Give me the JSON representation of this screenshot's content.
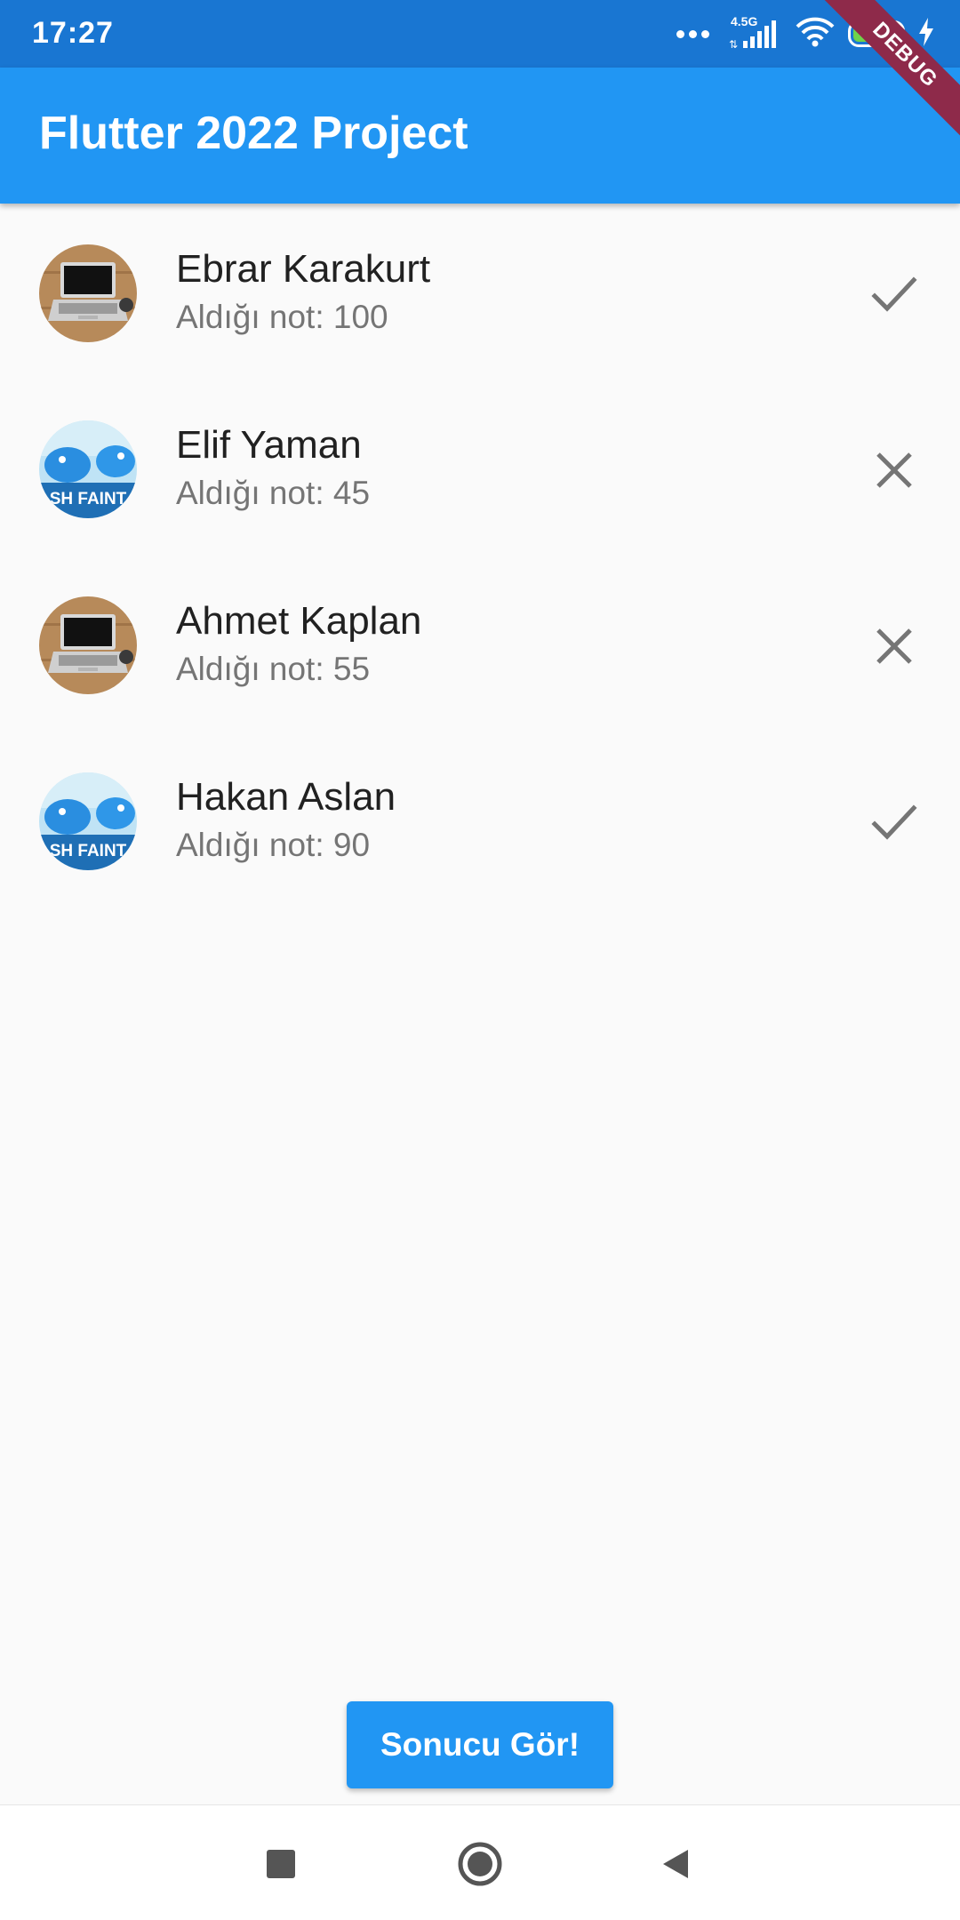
{
  "status_bar": {
    "time": "17:27",
    "network": "4.5G",
    "battery": "75",
    "battery_fraction": 0.75
  },
  "app_bar": {
    "title": "Flutter 2022 Project",
    "debug_banner": "DEBUG"
  },
  "students": [
    {
      "name": "Ebrar Karakurt",
      "grade_text": "Aldığı not: 100",
      "status_icon": "check-icon",
      "avatar": "laptop-image"
    },
    {
      "name": "Elif Yaman",
      "grade_text": "Aldığı not: 45",
      "status_icon": "close-icon",
      "avatar": "blue-bird-image"
    },
    {
      "name": "Ahmet Kaplan",
      "grade_text": "Aldığı not: 55",
      "status_icon": "close-icon",
      "avatar": "laptop-image"
    },
    {
      "name": "Hakan Aslan",
      "grade_text": "Aldığı not: 90",
      "status_icon": "check-icon",
      "avatar": "blue-bird-image"
    }
  ],
  "avatar_caption": "SH FAINT",
  "button": {
    "label": "Sonucu Gör!"
  },
  "nav_bar": {
    "icons": [
      "recents-icon",
      "home-icon",
      "back-icon"
    ]
  },
  "colors": {
    "primary": "#2196f3",
    "status_bar": "#1976d2",
    "icon_grey": "#757575",
    "debug": "#8e2a4a"
  }
}
